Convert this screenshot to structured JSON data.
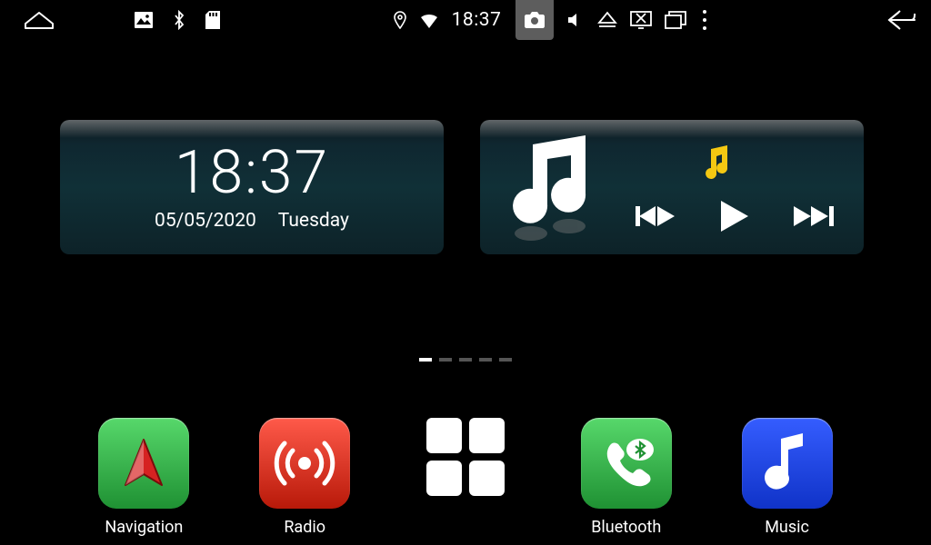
{
  "statusbar": {
    "clock": "18:37"
  },
  "clock_widget": {
    "time": "18:37",
    "date": "05/05/2020",
    "weekday": "Tuesday"
  },
  "pagination": {
    "pages": 5,
    "active_index": 0
  },
  "dock": {
    "items": [
      {
        "key": "navigation",
        "label": "Navigation",
        "color": "green"
      },
      {
        "key": "radio",
        "label": "Radio",
        "color": "red"
      },
      {
        "key": "apps",
        "label": "",
        "color": ""
      },
      {
        "key": "bluetooth",
        "label": "Bluetooth",
        "color": "green"
      },
      {
        "key": "music",
        "label": "Music",
        "color": "blue"
      }
    ]
  }
}
